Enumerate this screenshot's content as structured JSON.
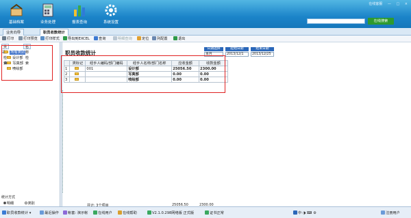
{
  "header": {
    "nav": [
      {
        "label": "基础档案",
        "icon": "basket-icon"
      },
      {
        "label": "业务处理",
        "icon": "calculator-icon"
      },
      {
        "label": "报表查询",
        "icon": "bar-chart-icon"
      },
      {
        "label": "系统设置",
        "icon": "gear-icon"
      }
    ],
    "top_right": [
      "在线客服",
      "—",
      "□",
      "×"
    ],
    "search_button": "在线搜索",
    "search_value": ""
  },
  "tabs": {
    "guide": "业务向导",
    "active": "职员收款统计"
  },
  "toolbar": {
    "print": "打印",
    "print_preview": "打印预览",
    "print_style": "打印样式",
    "export_excel": "导出到EXCEL",
    "query": "查询",
    "detail": "明细查询",
    "locate": "定位",
    "columns": "列配置",
    "exit": "退出"
  },
  "left_panel": {
    "tab1": "类别检索",
    "tab2": "名称检索",
    "tree": {
      "root": "所有类别",
      "children": [
        "设计部",
        "写真部",
        "喷绘部"
      ]
    },
    "stat_mode_label": "统计方式",
    "opt_detail": "明细",
    "opt_category": "类别"
  },
  "main": {
    "title": "职员收款统计",
    "filters": {
      "date_range_label": "日期选择",
      "date_range_value": "本月",
      "start_label": "起始日期",
      "start_value": "2013/12/1",
      "end_label": "结束日期",
      "end_value": "2013/12/25"
    },
    "columns": [
      "",
      "类标记",
      "经手人编码/部门编码",
      "经手人名称/部门名称",
      "应收金额",
      "收款金额"
    ],
    "rows": [
      {
        "no": "1",
        "code": "001",
        "name": "设计部",
        "due": "25056.50",
        "paid": "2300.00"
      },
      {
        "no": "2",
        "code": "",
        "name": "写真部",
        "due": "0.00",
        "paid": "0.00"
      },
      {
        "no": "3",
        "code": "",
        "name": "喷绘部",
        "due": "0.00",
        "paid": "0.00"
      }
    ],
    "footer": {
      "total_label": "共计: 3个项目",
      "due": "25056.50",
      "paid": "2300.00"
    }
  },
  "status": {
    "user": "职员收款统计",
    "recent": "最近操作",
    "account": "帐套: 演示帐",
    "online": "在线用户",
    "help": "在线帮助",
    "version": "V2.1.0.298网络版 正式版",
    "cert": "证书正常",
    "lang": "中",
    "register": "注册用户"
  },
  "colors": {
    "accent": "#1b84c9",
    "highlight": "#e02020"
  }
}
